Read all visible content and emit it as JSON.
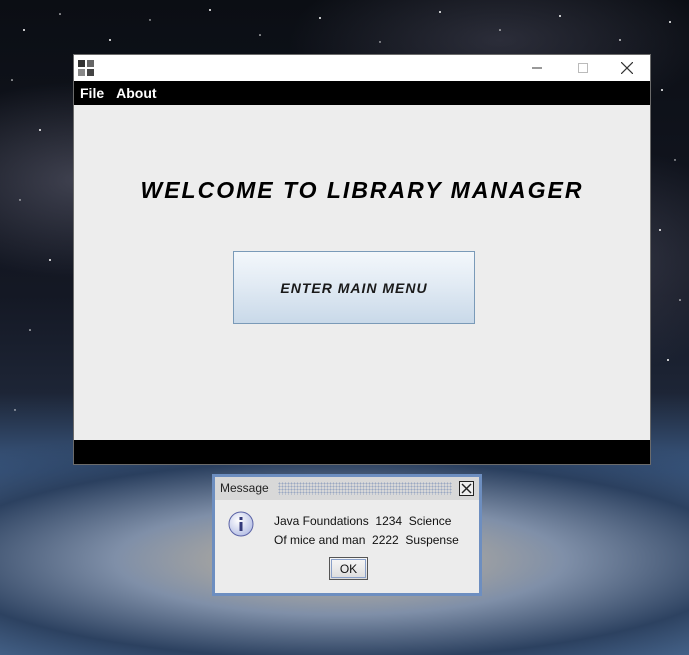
{
  "window": {
    "title": "",
    "controls": {
      "minimize": "minimize-icon",
      "maximize": "maximize-icon",
      "close": "close-icon"
    }
  },
  "menu": {
    "items": [
      "File",
      "About"
    ]
  },
  "main": {
    "welcome_text": "WELCOME TO LIBRARY MANAGER",
    "enter_button_label": "ENTER MAIN MENU"
  },
  "dialog": {
    "title": "Message",
    "lines": [
      "Java Foundations  1234  Science",
      "Of mice and man  2222  Suspense"
    ],
    "ok_label": "OK",
    "icon": "info-icon"
  },
  "colors": {
    "menu_bar": "#000000",
    "content_bg": "#ededed",
    "dialog_border": "#6d8ec0",
    "button_gradient_bottom": "#c9d9e9"
  }
}
